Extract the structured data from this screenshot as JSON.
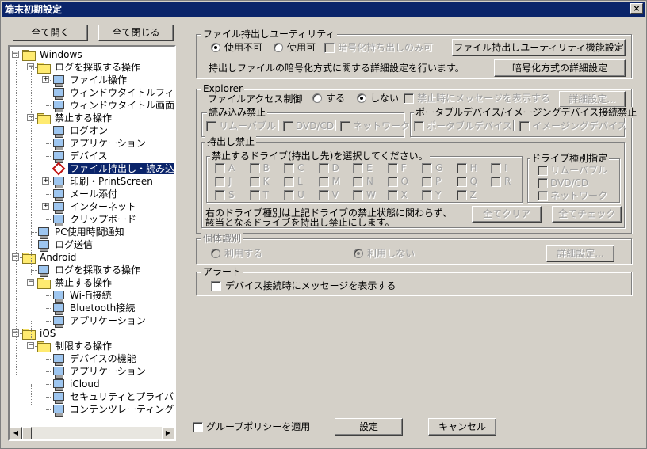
{
  "window": {
    "title": "端末初期設定",
    "close": "×"
  },
  "tree_buttons": {
    "expand_all": "全て開く",
    "collapse_all": "全て閉じる"
  },
  "tree": [
    {
      "label": "Windows",
      "icon": "folder-icon",
      "expander": "−"
    },
    {
      "label": "ログを採取する操作",
      "icon": "folder-icon",
      "expander": "−"
    },
    {
      "label": "ファイル操作",
      "icon": "monitor-icon",
      "expander": "+"
    },
    {
      "label": "ウィンドウタイトルフィルタ",
      "icon": "monitor-icon"
    },
    {
      "label": "ウィンドウタイトル画面キャ",
      "icon": "monitor-icon"
    },
    {
      "label": "禁止する操作",
      "icon": "folder-icon",
      "expander": "−"
    },
    {
      "label": "ログオン",
      "icon": "monitor-icon"
    },
    {
      "label": "アプリケーション",
      "icon": "monitor-icon"
    },
    {
      "label": "デバイス",
      "icon": "monitor-icon"
    },
    {
      "label": "ファイル持出し・読み込み",
      "icon": "diamond-icon",
      "selected": true
    },
    {
      "label": "印刷・PrintScreen",
      "icon": "monitor-icon",
      "expander": "+"
    },
    {
      "label": "メール添付",
      "icon": "monitor-icon"
    },
    {
      "label": "インターネット",
      "icon": "monitor-icon",
      "expander": "+"
    },
    {
      "label": "クリップボード",
      "icon": "monitor-icon"
    },
    {
      "label": "PC使用時間通知",
      "icon": "monitor-icon"
    },
    {
      "label": "ログ送信",
      "icon": "monitor-icon"
    },
    {
      "label": "Android",
      "icon": "folder-icon",
      "expander": "−"
    },
    {
      "label": "ログを採取する操作",
      "icon": "monitor-icon"
    },
    {
      "label": "禁止する操作",
      "icon": "folder-icon",
      "expander": "−"
    },
    {
      "label": "Wi-Fi接続",
      "icon": "monitor-icon"
    },
    {
      "label": "Bluetooth接続",
      "icon": "monitor-icon"
    },
    {
      "label": "アプリケーション",
      "icon": "monitor-icon"
    },
    {
      "label": "iOS",
      "icon": "folder-icon",
      "expander": "−"
    },
    {
      "label": "制限する操作",
      "icon": "folder-icon",
      "expander": "−"
    },
    {
      "label": "デバイスの機能",
      "icon": "monitor-icon"
    },
    {
      "label": "アプリケーション",
      "icon": "monitor-icon"
    },
    {
      "label": "iCloud",
      "icon": "monitor-icon"
    },
    {
      "label": "セキュリティとプライバシー",
      "icon": "monitor-icon"
    },
    {
      "label": "コンテンツレーティング",
      "icon": "monitor-icon"
    }
  ],
  "scroll": {
    "left": "◀",
    "right": "▶"
  },
  "utility": {
    "title": "ファイル持出しユーティリティ",
    "option_disabled": "使用不可",
    "option_enabled": "使用可",
    "encrypt_only": "暗号化持ち出しのみ可",
    "settings_button": "ファイル持出しユーティリティ機能設定",
    "encrypt_desc": "持出しファイルの暗号化方式に関する詳細設定を行います。",
    "encrypt_button": "暗号化方式の詳細設定"
  },
  "explorer": {
    "title": "Explorer",
    "access_label": "ファイルアクセス制御",
    "on": "する",
    "off": "しない",
    "show_msg": "禁止時にメッセージを表示する",
    "details_button": "詳細設定...",
    "read_group": {
      "title": "読み込み禁止",
      "items": [
        "リムーバブル",
        "DVD/CD",
        "ネットワーク"
      ]
    },
    "portable_group": {
      "title": "ポータブルデバイス/イメージングデバイス接続禁止",
      "items": [
        "ポータブルデバイス",
        "イメージングデバイス"
      ]
    },
    "export_group": {
      "title": "持出し禁止",
      "drive_group_title": "禁止するドライブ(持出し先)を選択してください。",
      "drives": [
        "A",
        "B",
        "C",
        "D",
        "E",
        "F",
        "G",
        "H",
        "I",
        "J",
        "K",
        "L",
        "M",
        "N",
        "O",
        "P",
        "Q",
        "R",
        "S",
        "T",
        "U",
        "V",
        "W",
        "X",
        "Y",
        "Z"
      ],
      "type_group_title": "ドライブ種別指定",
      "types": [
        "リムーバブル",
        "DVD/CD",
        "ネットワーク"
      ],
      "note_line1": "右のドライブ種別は上記ドライブの禁止状態に関わらず、",
      "note_line2": "該当となるドライブを持出し禁止にします。",
      "clear_all": "全てクリア",
      "check_all": "全てチェック"
    }
  },
  "identity": {
    "title": "個体識別",
    "use": "利用する",
    "not_use": "利用しない",
    "details_button": "詳細設定..."
  },
  "alert": {
    "title": "アラート",
    "show_msg": "デバイス接続時にメッセージを表示する"
  },
  "footer": {
    "group_policy": "グループポリシーを適用",
    "ok": "設定",
    "cancel": "キャンセル"
  }
}
